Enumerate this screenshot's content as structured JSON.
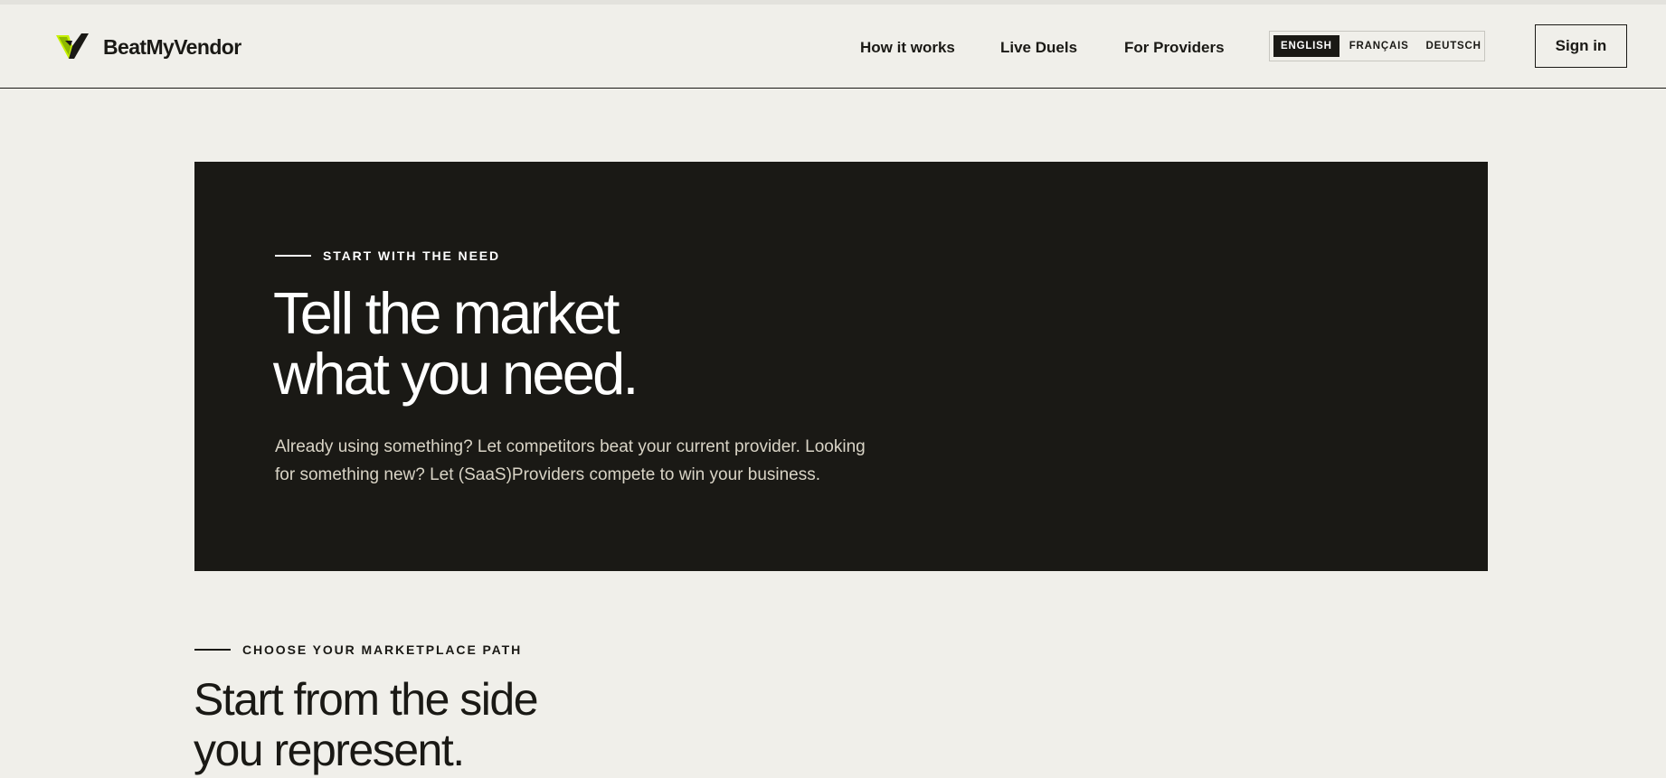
{
  "brand": {
    "name": "BeatMyVendor",
    "logo_icon": "v-check-logo-icon",
    "accent_color": "#c6f000",
    "dark_color": "#1a1915",
    "background_color": "#f0efea"
  },
  "nav": {
    "links": [
      {
        "label": "How it works"
      },
      {
        "label": "Live Duels"
      },
      {
        "label": "For Providers"
      }
    ],
    "languages": [
      {
        "label": "ENGLISH",
        "active": true
      },
      {
        "label": "FRANÇAIS",
        "active": false
      },
      {
        "label": "DEUTSCH",
        "active": false
      }
    ],
    "sign_in_label": "Sign in"
  },
  "hero": {
    "eyebrow": "START WITH THE NEED",
    "title_line1": "Tell the market",
    "title_line2": "what you need.",
    "subtitle_line1": "Already using something? Let competitors beat your current provider. Looking",
    "subtitle_line2": "for something new? Let (SaaS)Providers compete to win your business."
  },
  "marketplace": {
    "eyebrow": "CHOOSE YOUR MARKETPLACE PATH",
    "title_line1": "Start from the side",
    "title_line2": "you represent."
  }
}
